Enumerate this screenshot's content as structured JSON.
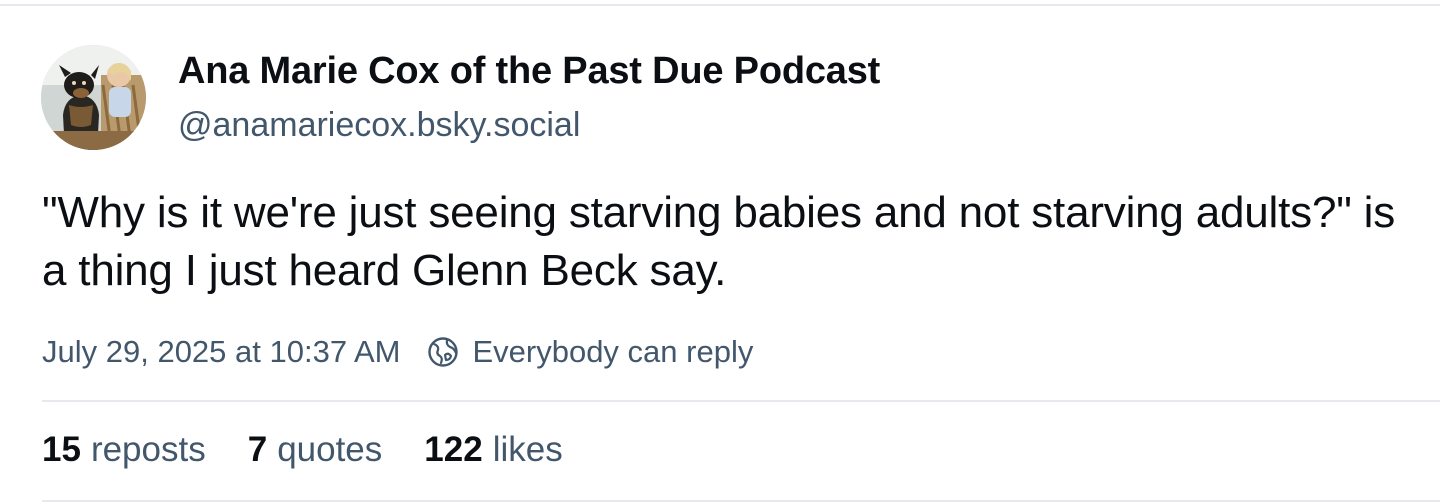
{
  "author": {
    "display_name": "Ana Marie Cox of the Past Due Podcast",
    "handle": "@anamariecox.bsky.social"
  },
  "post": {
    "text": "\"Why is it we're just seeing starving babies and not starving adults?\" is a thing I just heard Glenn Beck say.",
    "timestamp": "July 29, 2025 at 10:37 AM",
    "reply_setting": "Everybody can reply",
    "reply_setting_icon": "globe-icon"
  },
  "stats": {
    "reposts": {
      "count": "15",
      "label": "reposts"
    },
    "quotes": {
      "count": "7",
      "label": "quotes"
    },
    "likes": {
      "count": "122",
      "label": "likes"
    }
  },
  "colors": {
    "text": "#0b0f14",
    "muted": "#42576c",
    "divider": "#e6e9ed"
  }
}
